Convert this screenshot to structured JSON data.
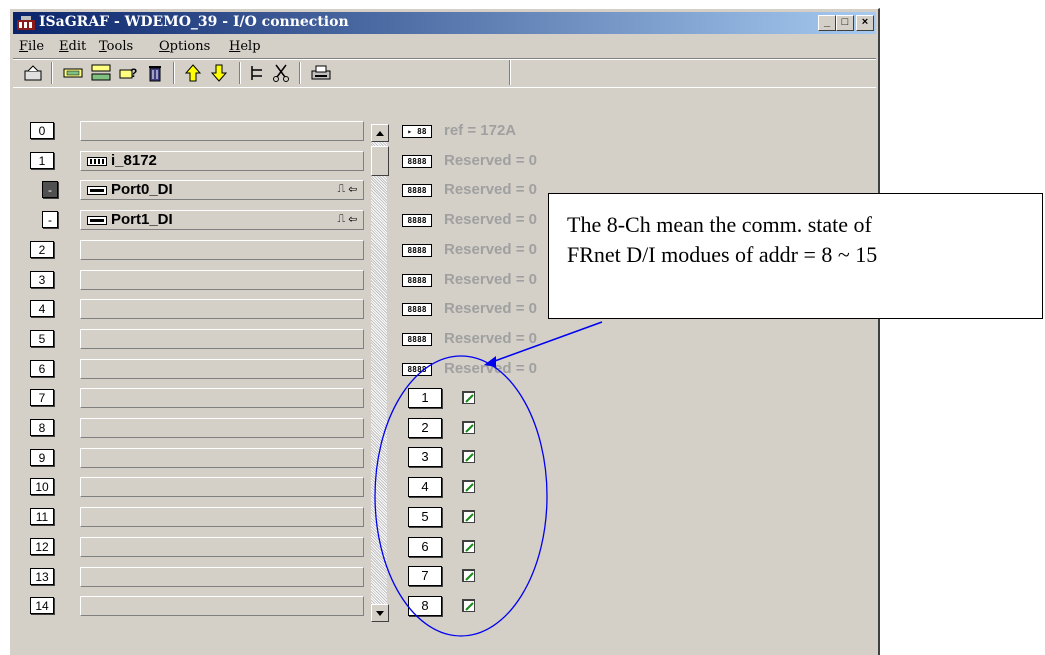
{
  "window": {
    "title": "ISaGRAF - WDEMO_39 - I/O connection",
    "controls": {
      "minimize": "_",
      "maximize": "□",
      "close": "×"
    }
  },
  "menu": [
    {
      "pre": "",
      "ul": "F",
      "post": "ile"
    },
    {
      "pre": "",
      "ul": "E",
      "post": "dit"
    },
    {
      "pre": "",
      "ul": "T",
      "post": "ools"
    },
    {
      "pre": "",
      "ul": "O",
      "post": "ptions"
    },
    {
      "pre": "",
      "ul": "H",
      "post": "elp"
    }
  ],
  "toolbar": {
    "icons": [
      "open-icon",
      "connect-board-icon",
      "set-board-icon",
      "help-board-icon",
      "delete-icon",
      "move-up-icon",
      "move-down-icon",
      "tree-icon",
      "cut-icon",
      "print-icon"
    ]
  },
  "slots": [
    {
      "num": "0",
      "label": "",
      "icon": "",
      "suffix": ""
    },
    {
      "num": "1",
      "label": "i_8172",
      "icon": "board-icon",
      "suffix": ""
    },
    {
      "num": "-",
      "label": "Port0_DI",
      "icon": "port-icon",
      "suffix": "⎍ ⇦",
      "style": "dark"
    },
    {
      "num": "-",
      "label": "Port1_DI",
      "icon": "port-icon",
      "suffix": "⎍ ⇦",
      "style": "small"
    },
    {
      "num": "2",
      "label": "",
      "icon": "",
      "suffix": ""
    },
    {
      "num": "3",
      "label": "",
      "icon": "",
      "suffix": ""
    },
    {
      "num": "4",
      "label": "",
      "icon": "",
      "suffix": ""
    },
    {
      "num": "5",
      "label": "",
      "icon": "",
      "suffix": ""
    },
    {
      "num": "6",
      "label": "",
      "icon": "",
      "suffix": ""
    },
    {
      "num": "7",
      "label": "",
      "icon": "",
      "suffix": ""
    },
    {
      "num": "8",
      "label": "",
      "icon": "",
      "suffix": ""
    },
    {
      "num": "9",
      "label": "",
      "icon": "",
      "suffix": ""
    },
    {
      "num": "10",
      "label": "",
      "icon": "",
      "suffix": ""
    },
    {
      "num": "11",
      "label": "",
      "icon": "",
      "suffix": ""
    },
    {
      "num": "12",
      "label": "",
      "icon": "",
      "suffix": ""
    },
    {
      "num": "13",
      "label": "",
      "icon": "",
      "suffix": ""
    },
    {
      "num": "14",
      "label": "",
      "icon": "",
      "suffix": ""
    }
  ],
  "registers": [
    {
      "icon": "▸ 88",
      "text": "ref = 172A"
    },
    {
      "icon": "8888",
      "text": "Reserved = 0"
    },
    {
      "icon": "8888",
      "text": "Reserved = 0"
    },
    {
      "icon": "8888",
      "text": "Reserved = 0"
    },
    {
      "icon": "8888",
      "text": "Reserved = 0"
    },
    {
      "icon": "8888",
      "text": "Reserved = 0"
    },
    {
      "icon": "8888",
      "text": "Reserved = 0"
    },
    {
      "icon": "8888",
      "text": "Reserved = 0"
    },
    {
      "icon": "8888",
      "text": "Reserved = 0"
    }
  ],
  "channels": [
    "1",
    "2",
    "3",
    "4",
    "5",
    "6",
    "7",
    "8"
  ],
  "callout": {
    "line1": "The 8-Ch mean the comm. state of",
    "line2": "FRnet D/I modues of addr = 8 ~ 15"
  },
  "colors": {
    "titlebar_start": "#0a246a",
    "titlebar_end": "#a6caf0",
    "annotation": "#0000ee",
    "check": "#1a8a1a"
  }
}
